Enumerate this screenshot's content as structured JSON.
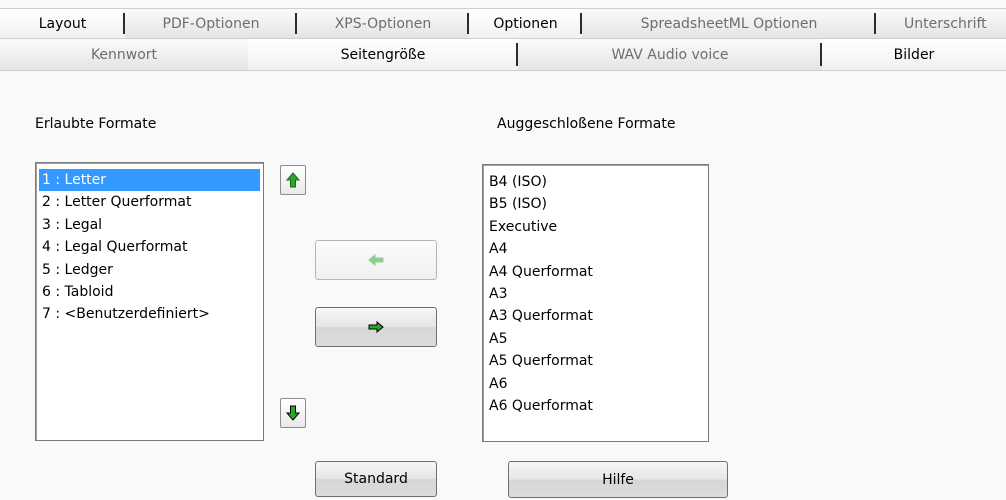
{
  "tabs_top": [
    {
      "label": "Layout",
      "active": true
    },
    {
      "label": "PDF-Optionen",
      "active": false
    },
    {
      "label": "XPS-Optionen",
      "active": false
    },
    {
      "label": "Optionen",
      "active": true
    },
    {
      "label": "SpreadsheetML Optionen",
      "active": false
    },
    {
      "label": "Unterschrift",
      "active": false
    }
  ],
  "tabs_bottom": [
    {
      "label": "Kennwort",
      "active": false
    },
    {
      "label": "Seitengröße",
      "active": true
    },
    {
      "label": "WAV Audio voice",
      "active": false
    },
    {
      "label": "Bilder",
      "active": true
    }
  ],
  "allowed": {
    "label": "Erlaubte Formate",
    "items": [
      "1 : Letter",
      "2 : Letter Querformat",
      "3 : Legal",
      "4 : Legal Querformat",
      "5 : Ledger",
      "6 : Tabloid",
      "7 : <Benutzerdefiniert>"
    ],
    "selected_index": 0
  },
  "excluded": {
    "label": "Auggeschloßene Formate",
    "items": [
      "B4 (ISO)",
      "B5 (ISO)",
      "Executive",
      "A4",
      "A4 Querformat",
      "A3",
      "A3 Querformat",
      "A5",
      "A5 Querformat",
      "A6",
      "A6 Querformat"
    ]
  },
  "buttons": {
    "move_up_icon": "arrow-up-icon",
    "move_down_icon": "arrow-down-icon",
    "move_left_icon": "arrow-left-icon",
    "move_right_icon": "arrow-right-icon",
    "standard": "Standard",
    "help": "Hilfe"
  },
  "colors": {
    "selection": "#3399ff",
    "arrow_green": "#2aa82a",
    "arrow_disabled": "#8fce8f"
  }
}
